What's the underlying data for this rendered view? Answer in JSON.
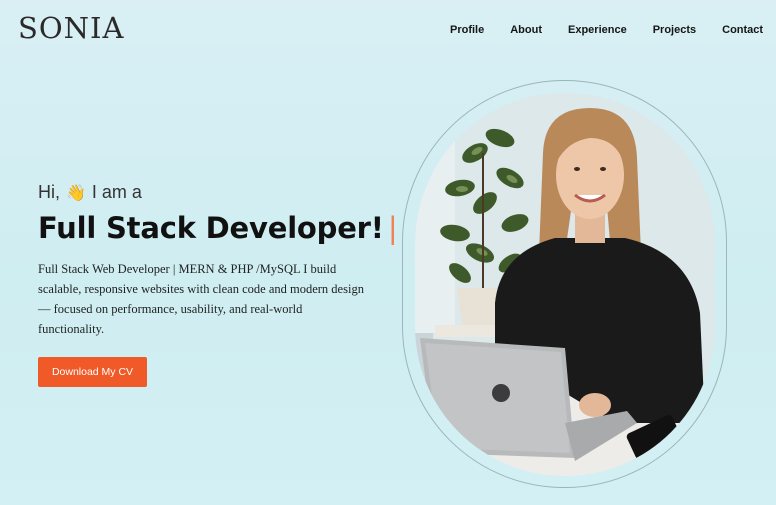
{
  "brand": {
    "logo_text": "SONIA"
  },
  "nav": {
    "items": [
      {
        "label": "Profile"
      },
      {
        "label": "About"
      },
      {
        "label": "Experience"
      },
      {
        "label": "Projects"
      },
      {
        "label": "Contact"
      }
    ]
  },
  "hero": {
    "greeting_hi": "Hi,",
    "greeting_wave": "👋",
    "greeting_rest": "I am a",
    "headline": "Full Stack Developer!",
    "cursor": "|",
    "description": "Full Stack Web Developer | MERN & PHP /MySQL I build scalable, responsive websites with clean code and modern design — focused on performance, usability, and real-world functionality.",
    "cta_label": "Download My CV"
  },
  "colors": {
    "accent": "#f05a28",
    "cursor": "#f08055",
    "background": "#d4eff3"
  },
  "icons": {
    "greeting": "waving-hand-icon"
  }
}
